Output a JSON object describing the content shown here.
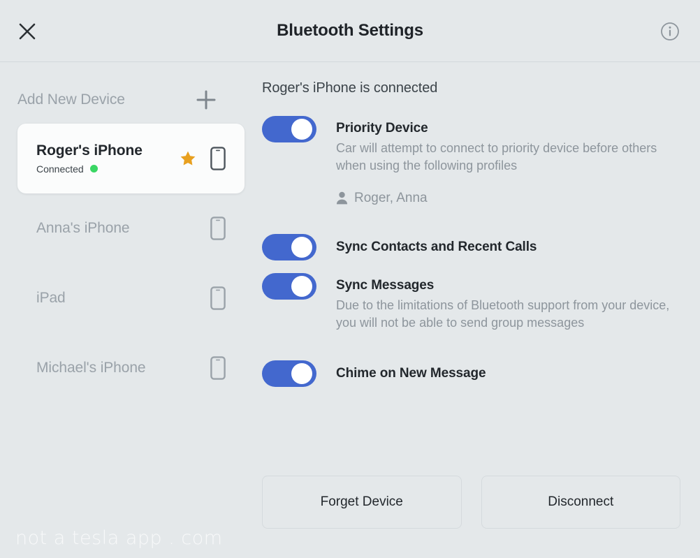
{
  "header": {
    "title": "Bluetooth Settings",
    "close_icon": "close-icon",
    "info_icon": "info-icon"
  },
  "sidebar": {
    "add_device": {
      "label": "Add New Device",
      "icon": "plus-icon"
    },
    "devices": [
      {
        "name": "Roger's iPhone",
        "status": "Connected",
        "selected": true,
        "favorite": true,
        "status_color": "#3ad664",
        "star_color": "#e8a01f",
        "device_icon": "phone-icon"
      },
      {
        "name": "Anna's iPhone",
        "status": "",
        "selected": false,
        "favorite": false,
        "device_icon": "phone-icon"
      },
      {
        "name": "iPad",
        "status": "",
        "selected": false,
        "favorite": false,
        "device_icon": "tablet-icon"
      },
      {
        "name": "Michael's iPhone",
        "status": "",
        "selected": false,
        "favorite": false,
        "device_icon": "phone-icon"
      }
    ]
  },
  "detail": {
    "heading": "Roger's iPhone is connected",
    "settings": [
      {
        "title": "Priority Device",
        "description": "Car will attempt to connect to priority device before others when using the following profiles",
        "enabled": true
      },
      {
        "title": "Sync Contacts and Recent Calls",
        "description": "",
        "enabled": true
      },
      {
        "title": "Sync Messages",
        "description": "Due to the limitations of Bluetooth support from your device, you will not be able to send group messages",
        "enabled": true
      },
      {
        "title": "Chime on New Message",
        "description": "",
        "enabled": true
      }
    ],
    "profiles": {
      "icon": "person-icon",
      "names": "Roger, Anna"
    },
    "actions": {
      "forget": "Forget Device",
      "disconnect": "Disconnect"
    }
  },
  "watermark": "not a tesla app . com",
  "colors": {
    "background": "#e4e8ea",
    "toggle_on": "#4368ce",
    "accent_star": "#e8a01f",
    "status_connected": "#3ad664",
    "text_primary": "#22272c",
    "text_muted": "#8d959c"
  }
}
